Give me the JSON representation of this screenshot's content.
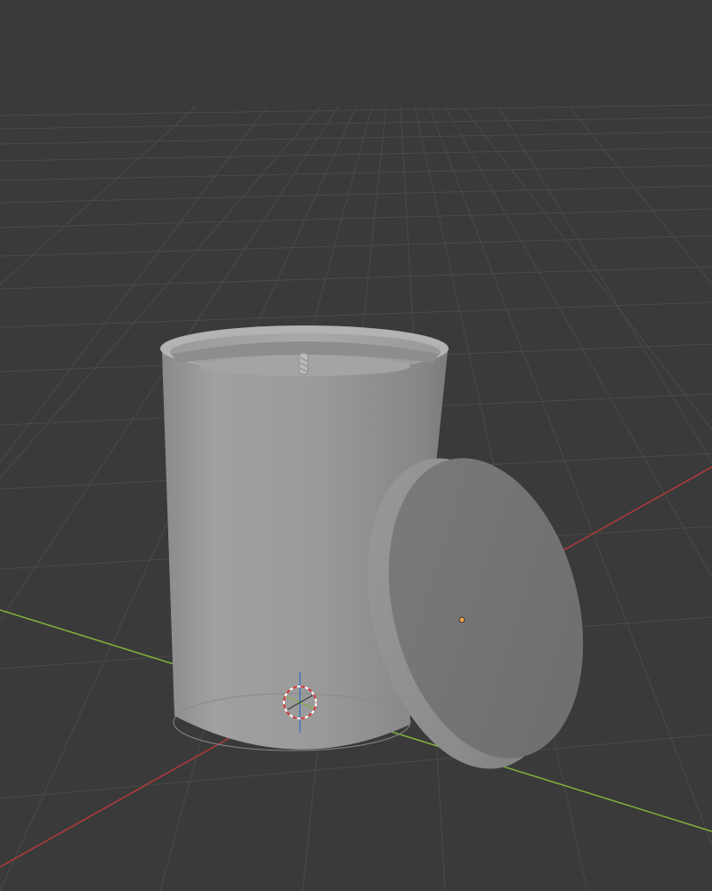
{
  "viewport": {
    "background_color": "#3a3a3a",
    "grid_color": "#4a4a4a",
    "x_axis_color": "#b53a3e",
    "y_axis_color": "#7fb23a",
    "z_axis_color": "#2f6fc0"
  },
  "objects": [
    {
      "kind": "candle-jar",
      "color": "#9a9a9a"
    },
    {
      "kind": "candle-wick",
      "color": "#b9b9b9"
    },
    {
      "kind": "jar-lid",
      "color": "#7a7a7a"
    }
  ],
  "origin_point_color": "#f0a04b",
  "cursor_colors": {
    "ring_red": "#d23b3b",
    "ring_white": "#ffffff"
  }
}
